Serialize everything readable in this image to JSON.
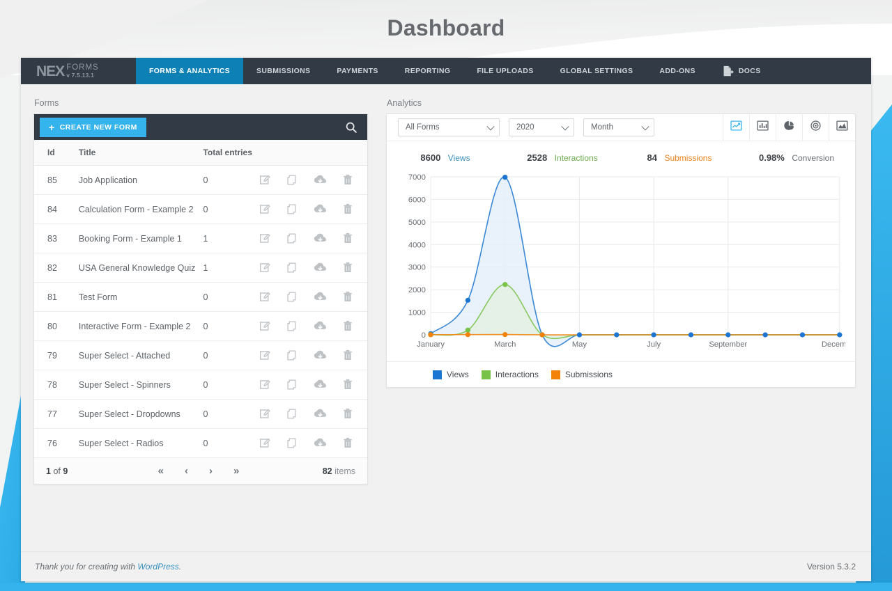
{
  "page": {
    "title": "Dashboard",
    "accent_blue": "#35b3ec",
    "nav_dark": "#323a45",
    "active_tab_blue": "#0d81b5"
  },
  "brand": {
    "nex": "NEX",
    "forms": "FORMS",
    "version": "v 7.5.13.1"
  },
  "nav": {
    "items": [
      {
        "label": "FORMS & ANALYTICS",
        "active": true,
        "icon": ""
      },
      {
        "label": "SUBMISSIONS",
        "active": false,
        "icon": ""
      },
      {
        "label": "PAYMENTS",
        "active": false,
        "icon": ""
      },
      {
        "label": "REPORTING",
        "active": false,
        "icon": ""
      },
      {
        "label": "FILE UPLOADS",
        "active": false,
        "icon": ""
      },
      {
        "label": "GLOBAL SETTINGS",
        "active": false,
        "icon": ""
      },
      {
        "label": "ADD-ONS",
        "active": false,
        "icon": ""
      },
      {
        "label": "DOCS",
        "active": false,
        "icon": "document-export-icon"
      }
    ]
  },
  "forms_panel": {
    "label": "Forms",
    "create_button": "CREATE NEW FORM",
    "search_icon": "search-icon",
    "columns": [
      "Id",
      "Title",
      "Total entries"
    ],
    "row_action_icons": [
      "edit-icon",
      "duplicate-icon",
      "cloud-download-icon",
      "trash-icon"
    ],
    "rows": [
      {
        "id": "85",
        "title": "Job Application",
        "entries": "0"
      },
      {
        "id": "84",
        "title": "Calculation Form - Example 2",
        "entries": "0"
      },
      {
        "id": "83",
        "title": "Booking Form - Example 1",
        "entries": "1"
      },
      {
        "id": "82",
        "title": "USA General Knowledge Quiz",
        "entries": "1"
      },
      {
        "id": "81",
        "title": "Test Form",
        "entries": "0"
      },
      {
        "id": "80",
        "title": "Interactive Form - Example 2",
        "entries": "0"
      },
      {
        "id": "79",
        "title": "Super Select - Attached",
        "entries": "0"
      },
      {
        "id": "78",
        "title": "Super Select - Spinners",
        "entries": "0"
      },
      {
        "id": "77",
        "title": "Super Select - Dropdowns",
        "entries": "0"
      },
      {
        "id": "76",
        "title": "Super Select - Radios",
        "entries": "0"
      }
    ],
    "pager": {
      "current_page": "1",
      "page_of": "of",
      "total_pages": "9",
      "first_icon": "«",
      "prev_icon": "‹",
      "next_icon": "›",
      "last_icon": "»",
      "item_count": "82",
      "items_label": "items"
    }
  },
  "analytics_panel": {
    "label": "Analytics",
    "filters": {
      "form": {
        "value": "All Forms"
      },
      "year": {
        "value": "2020"
      },
      "period": {
        "value": "Month"
      }
    },
    "chart_type_buttons": [
      {
        "icon": "line-chart-icon",
        "active": true
      },
      {
        "icon": "bar-chart-icon",
        "active": false
      },
      {
        "icon": "pie-chart-icon",
        "active": false
      },
      {
        "icon": "doughnut-chart-icon",
        "active": false
      },
      {
        "icon": "area-chart-icon",
        "active": false
      }
    ],
    "stats": [
      {
        "value": "8600",
        "label": "Views",
        "color": "#3a8fc0"
      },
      {
        "value": "2528",
        "label": "Interactions",
        "color": "#6aab4a"
      },
      {
        "value": "84",
        "label": "Submissions",
        "color": "#e8821a"
      },
      {
        "value": "0.98%",
        "label": "Conversion",
        "color": "#6a6f74"
      }
    ],
    "legend": [
      {
        "label": "Views",
        "color": "#1c75d0"
      },
      {
        "label": "Interactions",
        "color": "#78c247"
      },
      {
        "label": "Submissions",
        "color": "#f2820a"
      }
    ]
  },
  "chart_data": {
    "type": "line",
    "title": "",
    "xlabel": "",
    "ylabel": "",
    "ylim": [
      0,
      7000
    ],
    "y_ticks": [
      0,
      1000,
      2000,
      3000,
      4000,
      5000,
      6000,
      7000
    ],
    "grid": true,
    "legend_position": "bottom",
    "x": [
      "January",
      "February",
      "March",
      "April",
      "May",
      "June",
      "July",
      "August",
      "September",
      "October",
      "November",
      "December"
    ],
    "x_tick_labels": [
      "January",
      "",
      "March",
      "",
      "May",
      "",
      "July",
      "",
      "September",
      "",
      "",
      "December"
    ],
    "series": [
      {
        "name": "Views",
        "color": "#1c75d0",
        "fill": "#e4eff9",
        "values": [
          50,
          1530,
          6980,
          0,
          0,
          0,
          0,
          0,
          0,
          0,
          0,
          0
        ]
      },
      {
        "name": "Interactions",
        "color": "#78c247",
        "fill": "#e4efe2",
        "values": [
          10,
          210,
          2230,
          0,
          0,
          0,
          0,
          0,
          0,
          0,
          0,
          0
        ]
      },
      {
        "name": "Submissions",
        "color": "#f2820a",
        "fill": "#fbefdf",
        "values": [
          4,
          10,
          14,
          0,
          0,
          0,
          0,
          0,
          0,
          0,
          0,
          0
        ]
      }
    ]
  },
  "footer": {
    "thanks_prefix": "Thank you for creating with ",
    "wordpress_link": "WordPress",
    "thanks_suffix": ".",
    "version": "Version 5.3.2"
  }
}
